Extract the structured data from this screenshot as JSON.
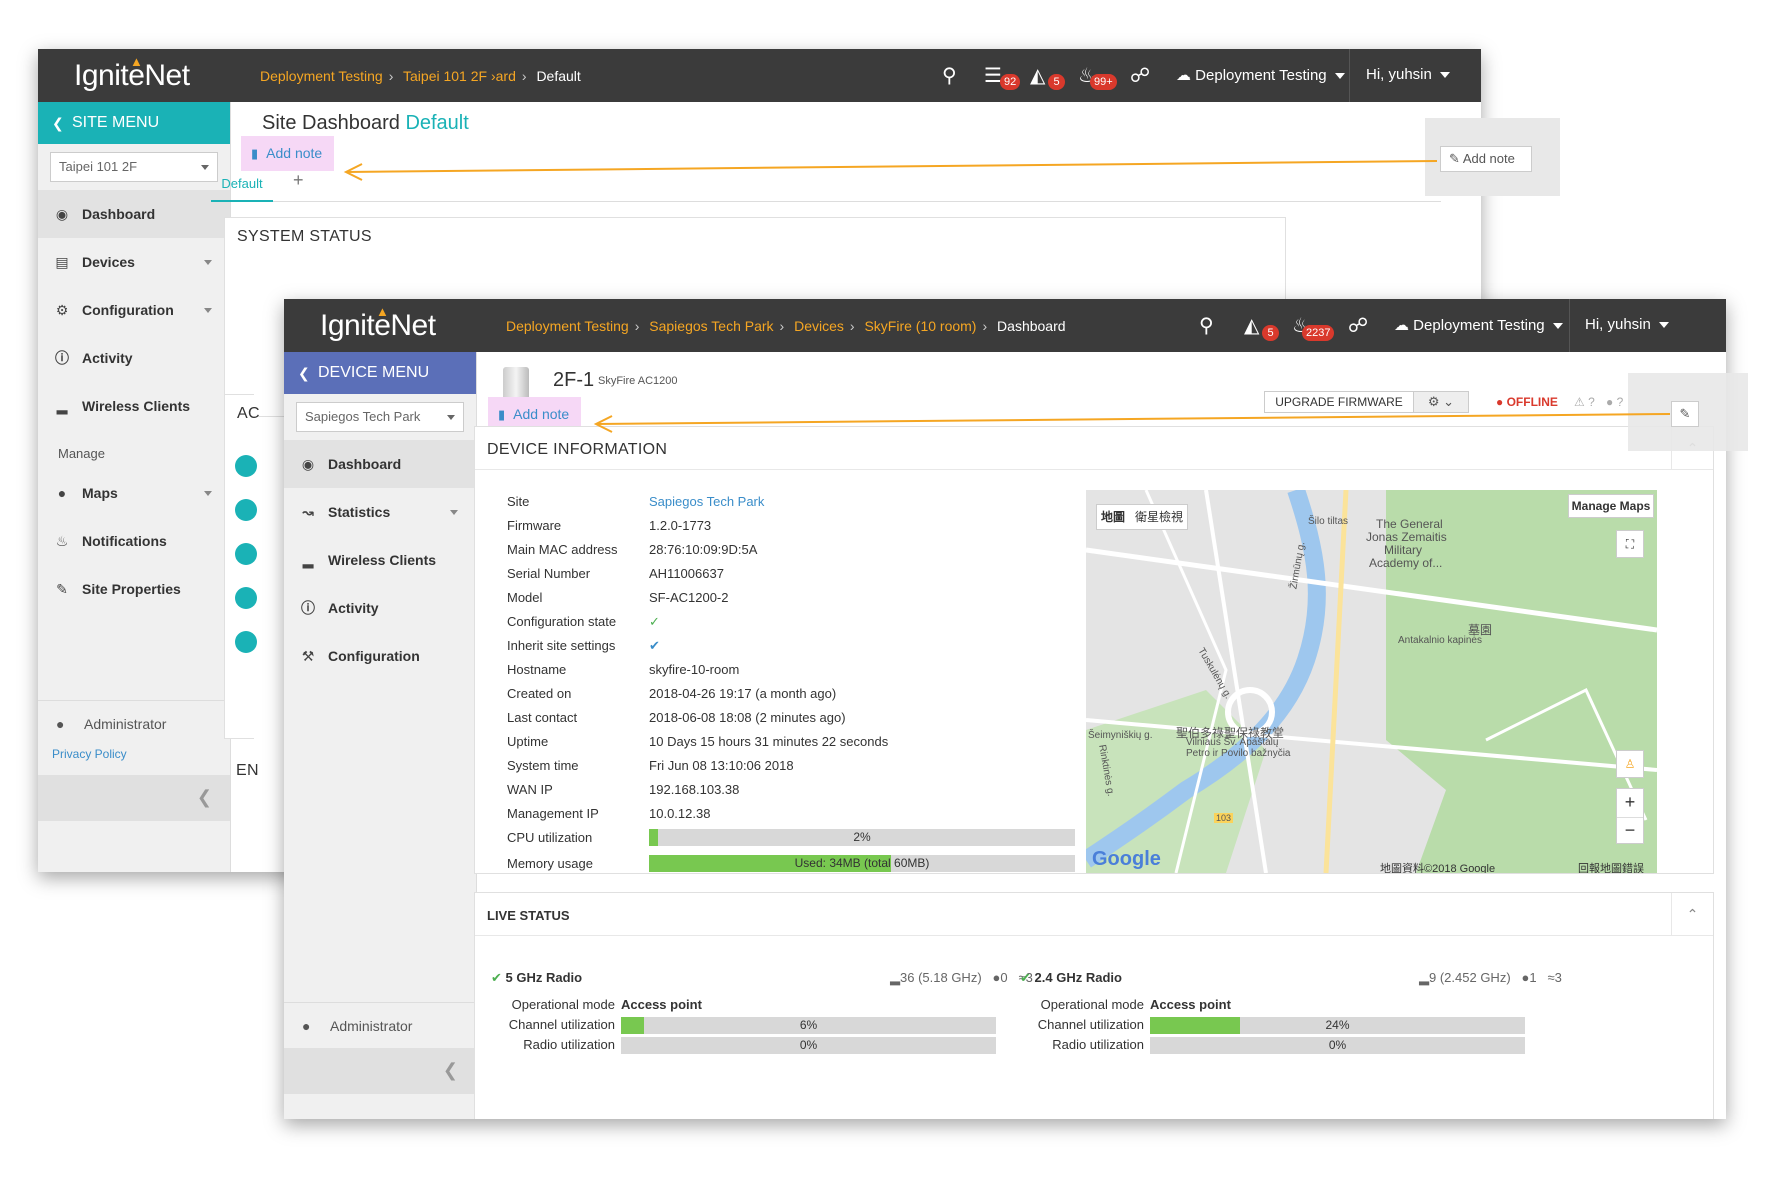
{
  "back": {
    "logo": "IgniteNet",
    "crumbs": [
      "Deployment Testing",
      "Taipei 101 2F",
      "›ard"
    ],
    "crumb_current": "Default",
    "badges": {
      "list": "92",
      "inbox": "5",
      "bell": "99+"
    },
    "org": "Deployment Testing",
    "user": "Hi, yuhsin",
    "menu_title": "SITE MENU",
    "site_select": "Taipei 101 2F",
    "nav": [
      "Dashboard",
      "Devices",
      "Configuration",
      "Activity",
      "Wireless Clients"
    ],
    "manage_label": "Manage",
    "manage_nav": [
      "Maps",
      "Notifications",
      "Site Properties"
    ],
    "admin": "Administrator",
    "privacy": "Privacy Policy",
    "title_prefix": "Site Dashboard",
    "title_accent": "Default",
    "add_note": "Add note",
    "tab_default": "Default",
    "tab_add": "+",
    "system_status": "SYSTEM STATUS",
    "partial_ac": "AC",
    "partial_en": "EN",
    "right_add_note": "Add note"
  },
  "front": {
    "logo": "IgniteNet",
    "crumbs": [
      "Deployment Testing",
      "Sapiegos Tech Park",
      "Devices",
      "SkyFire (10 room)"
    ],
    "crumb_current": "Dashboard",
    "badges": {
      "inbox": "5",
      "bell": "2237"
    },
    "org": "Deployment Testing",
    "user": "Hi, yuhsin",
    "menu_title": "DEVICE MENU",
    "site_select": "Sapiegos Tech Park",
    "nav": [
      "Dashboard",
      "Statistics",
      "Wireless Clients",
      "Activity",
      "Configuration"
    ],
    "admin": "Administrator",
    "device_name": "2F-1",
    "device_model": "SkyFire AC1200",
    "add_note": "Add note",
    "upgrade_btn": "UPGRADE FIRMWARE",
    "status": "OFFLINE",
    "warn_count": "?",
    "user_count": "?",
    "device_info_title": "DEVICE INFORMATION",
    "info": [
      {
        "k": "Site",
        "v": "Sapiegos Tech Park"
      },
      {
        "k": "Firmware",
        "v": "1.2.0-1773"
      },
      {
        "k": "Main MAC address",
        "v": "28:76:10:09:9D:5A"
      },
      {
        "k": "Serial Number",
        "v": "AH11006637"
      },
      {
        "k": "Model",
        "v": "SF-AC1200-2"
      },
      {
        "k": "Configuration state",
        "v": "✓"
      },
      {
        "k": "Inherit site settings",
        "v": "✔"
      },
      {
        "k": "Hostname",
        "v": "skyfire-10-room"
      },
      {
        "k": "Created on",
        "v": "2018-04-26 19:17 (a month ago)"
      },
      {
        "k": "Last contact",
        "v": "2018-06-08 18:08 (2 minutes ago)"
      },
      {
        "k": "Uptime",
        "v": "10 Days 15 hours 31 minutes 22 seconds"
      },
      {
        "k": "System time",
        "v": "Fri Jun 08 13:10:06 2018"
      },
      {
        "k": "WAN IP",
        "v": "192.168.103.38"
      },
      {
        "k": "Management IP",
        "v": "10.0.12.38"
      }
    ],
    "cpu_label": "CPU utilization",
    "cpu_text": "2%",
    "cpu_value": 0.02,
    "mem_label": "Memory usage",
    "mem_text": "Used: 34MB (total 60MB)",
    "mem_value": 0.567,
    "map": {
      "tab_map": "地圖",
      "tab_sat": "衛星檢視",
      "manage": "Manage Maps",
      "labels": [
        "The General",
        "Jonas Zemaitis",
        "Military",
        "Academy of...",
        "Antakalnio kapinės",
        "墓園",
        "Šilo tiltas",
        "Žirmūnų g.",
        "Tuskulėnų g.",
        "Šeimyniškių g.",
        "聖伯多祿聖保祿教堂",
        "Vilniaus Šv. Apaštalų",
        "Petro ir Povilo bažnyčia",
        "Rinktinės g.",
        "103"
      ],
      "google": "Google",
      "copyright": "地圖資料©2018 Google",
      "report": "回報地圖錯誤",
      "zoom_in": "+",
      "zoom_out": "−"
    },
    "live_title": "LIVE STATUS",
    "radio5": {
      "title": "5 GHz Radio",
      "meta_channel": "36 (5.18 GHz)",
      "meta_users": "0",
      "meta_rss": "3",
      "op_label": "Operational mode",
      "op_value": "Access point",
      "chan_label": "Channel utilization",
      "chan_text": "6%",
      "chan_value": 0.06,
      "radio_label": "Radio utilization",
      "radio_text": "0%"
    },
    "radio24": {
      "title": "2.4 GHz Radio",
      "meta_channel": "9 (2.452 GHz)",
      "meta_users": "1",
      "meta_rss": "3",
      "op_label": "Operational mode",
      "op_value": "Access point",
      "chan_label": "Channel utilization",
      "chan_text": "24%",
      "chan_value": 0.24,
      "radio_label": "Radio utilization",
      "radio_text": "0%"
    }
  },
  "colors": {
    "teal": "#1ab2b6",
    "device_menu": "#5b6fb8",
    "accent_orange": "#f5a623",
    "note_highlight": "#f6d8f6",
    "link": "#3a8dc9",
    "green": "#78c850"
  }
}
